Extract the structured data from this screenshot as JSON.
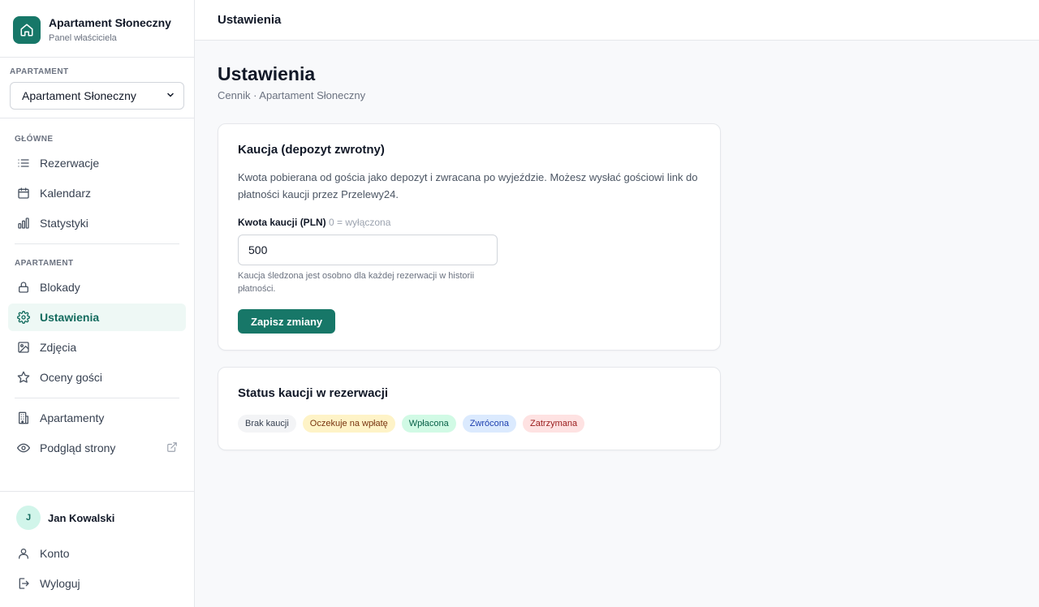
{
  "brand": {
    "title": "Apartament Słoneczny",
    "subtitle": "Panel właściciela",
    "icon": "home-icon"
  },
  "apartment_picker": {
    "label": "APARTAMENT",
    "selected": "Apartament Słoneczny"
  },
  "nav": {
    "main_label": "GŁÓWNE",
    "main_items": [
      {
        "label": "Rezerwacje",
        "icon": "list-icon"
      },
      {
        "label": "Kalendarz",
        "icon": "calendar-icon"
      },
      {
        "label": "Statystyki",
        "icon": "bar-chart-icon"
      }
    ],
    "apartment_label": "APARTAMENT",
    "apartment_items": [
      {
        "label": "Blokady",
        "icon": "lock-icon"
      },
      {
        "label": "Ustawienia",
        "icon": "gear-icon",
        "active": true
      },
      {
        "label": "Zdjęcia",
        "icon": "image-icon"
      },
      {
        "label": "Oceny gości",
        "icon": "star-icon"
      }
    ],
    "extra_items": [
      {
        "label": "Apartamenty",
        "icon": "building-icon"
      },
      {
        "label": "Podgląd strony",
        "icon": "eye-icon",
        "external": true
      }
    ]
  },
  "user": {
    "initial": "J",
    "name": "Jan Kowalski",
    "account": "Konto",
    "logout": "Wyloguj"
  },
  "topbar": {
    "title": "Ustawienia"
  },
  "page": {
    "title": "Ustawienia",
    "subtitle": "Cennik · Apartament Słoneczny"
  },
  "deposit_card": {
    "title": "Kaucja (depozyt zwrotny)",
    "description": "Kwota pobierana od gościa jako depozyt i zwracana po wyjeździe. Możesz wysłać gościowi link do płatności kaucji przez Przelewy24.",
    "field_label": "Kwota kaucji (PLN)",
    "field_hint": "0 = wyłączona",
    "field_value": "500",
    "help": "Kaucja śledzona jest osobno dla każdej rezerwacji w historii płatności.",
    "save_label": "Zapisz zmiany"
  },
  "status_card": {
    "title": "Status kaucji w rezerwacji",
    "badges": [
      {
        "label": "Brak kaucji",
        "bg": "#f3f4f6",
        "fg": "#374151"
      },
      {
        "label": "Oczekuje na wpłatę",
        "bg": "#fef3c7",
        "fg": "#78350f"
      },
      {
        "label": "Wpłacona",
        "bg": "#d1fae5",
        "fg": "#065f46"
      },
      {
        "label": "Zwrócona",
        "bg": "#dbeafe",
        "fg": "#1e40af"
      },
      {
        "label": "Zatrzymana",
        "bg": "#fee2e2",
        "fg": "#991b1b"
      }
    ]
  },
  "colors": {
    "accent": "#177768",
    "active_bg": "#eef8f5"
  }
}
